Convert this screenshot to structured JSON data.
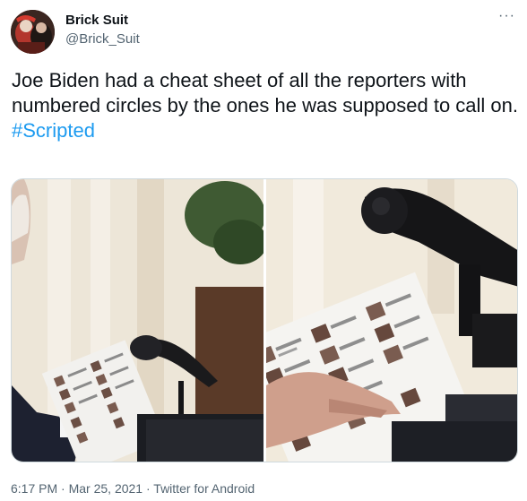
{
  "author": {
    "name": "Brick Suit",
    "handle": "@Brick_Suit"
  },
  "tweet": {
    "text": "Joe Biden had a cheat sheet of all the reporters with numbered circles by the ones he was supposed to call on.",
    "hashtag": "#Scripted"
  },
  "meta": {
    "time": "6:17 PM",
    "separator": " · ",
    "date": "Mar 25, 2021",
    "source": "Twitter for Android"
  },
  "icons": {
    "more": "more-options-icon"
  },
  "colors": {
    "link": "#1d9bf0",
    "secondary_text": "#536471",
    "primary_text": "#0f1419"
  }
}
